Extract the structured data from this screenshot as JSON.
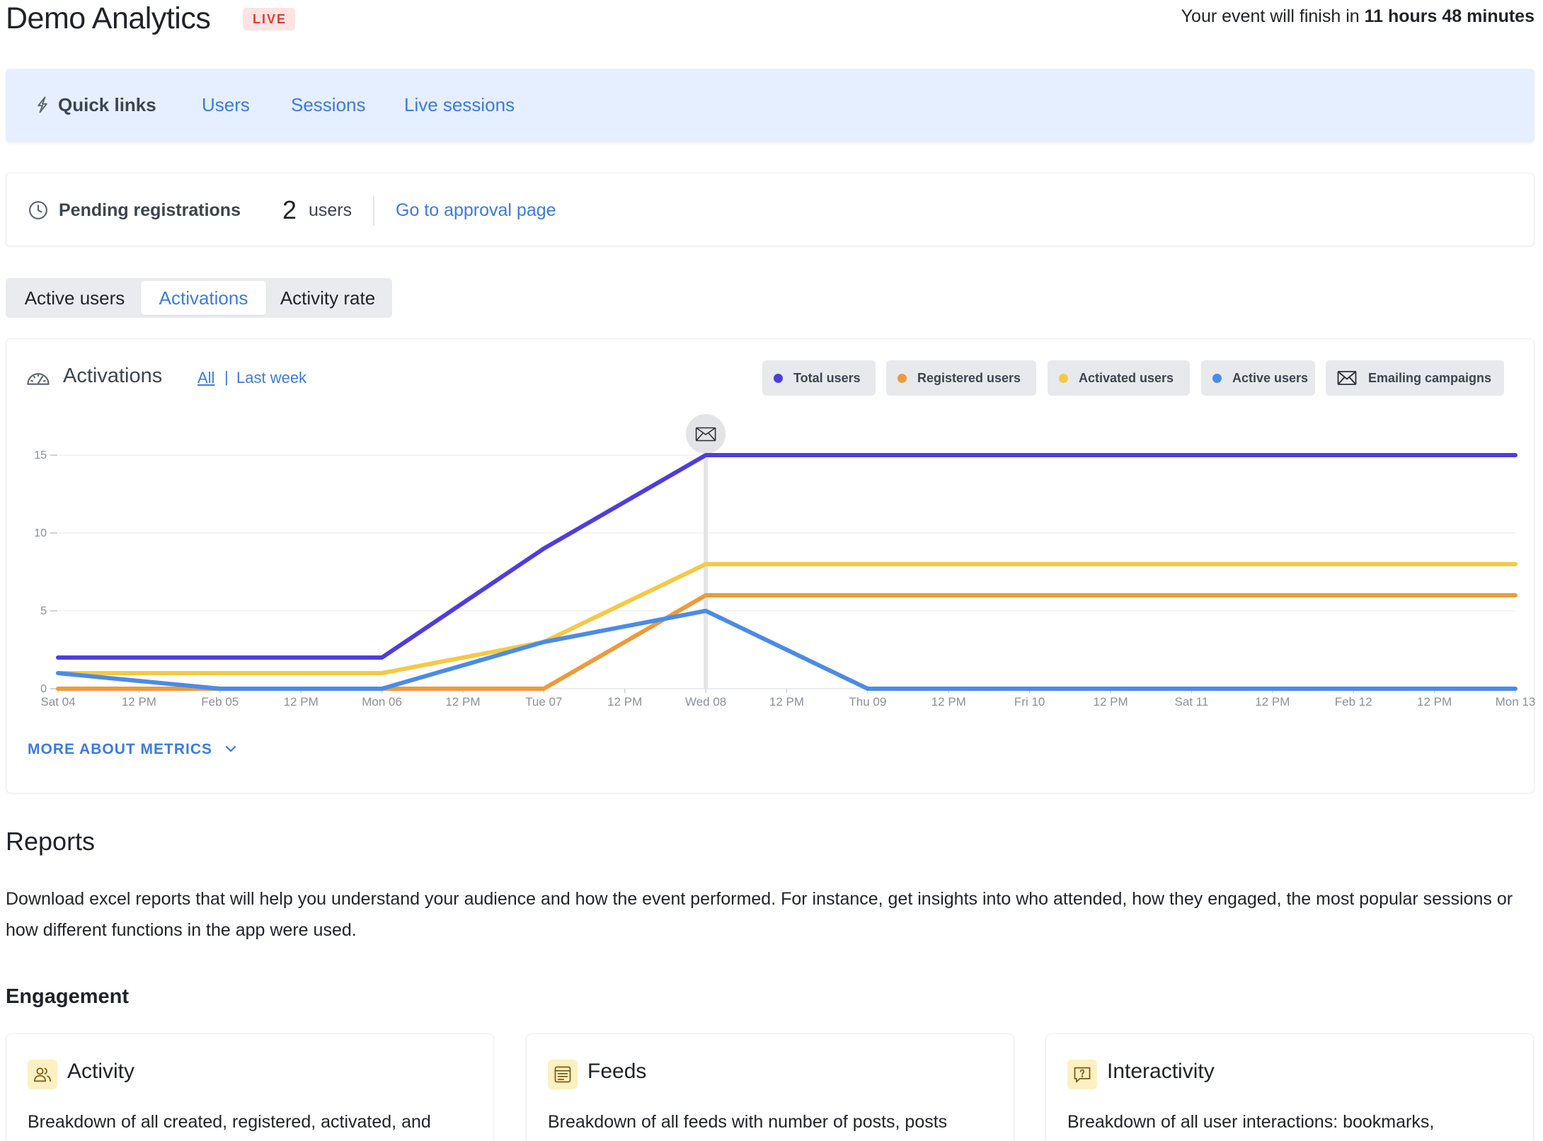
{
  "header": {
    "title": "Demo Analytics",
    "badge": "LIVE",
    "countdown_prefix": "Your event will finish in",
    "countdown_value": "11 hours 48 minutes"
  },
  "quick_links": {
    "title": "Quick links",
    "links": [
      "Users",
      "Sessions",
      "Live sessions"
    ]
  },
  "pending": {
    "label": "Pending registrations",
    "count": "2",
    "unit": "users",
    "link": "Go to approval page"
  },
  "tabs": [
    "Active users",
    "Activations",
    "Activity rate"
  ],
  "active_tab": "Activations",
  "chart_card": {
    "title": "Activations",
    "range_all": "All",
    "range_separator": "|",
    "range_last_week": "Last week",
    "more_metrics": "MORE ABOUT METRICS",
    "legend": [
      {
        "label": "Total users",
        "color": "#4e3ddf"
      },
      {
        "label": "Registered users",
        "color": "#ee9a3a"
      },
      {
        "label": "Activated users",
        "color": "#f5c945"
      },
      {
        "label": "Active users",
        "color": "#4b8be8"
      },
      {
        "label": "Emailing campaigns",
        "icon": "envelope-icon"
      }
    ]
  },
  "chart_data": {
    "type": "line",
    "x_ticks": [
      "Sat 04",
      "12 PM",
      "Feb 05",
      "12 PM",
      "Mon 06",
      "12 PM",
      "Tue 07",
      "12 PM",
      "Wed 08",
      "12 PM",
      "Thu 09",
      "12 PM",
      "Fri 10",
      "12 PM",
      "Sat 11",
      "12 PM",
      "Feb 12",
      "12 PM",
      "Mon 13"
    ],
    "x": [
      "Sat 04",
      "Feb 05",
      "Mon 06",
      "Tue 07",
      "Wed 08",
      "Thu 09",
      "Fri 10",
      "Sat 11",
      "Feb 12",
      "Mon 13"
    ],
    "y_ticks": [
      0,
      5,
      10,
      15
    ],
    "ylim": [
      0,
      15
    ],
    "grid": true,
    "campaign_marker_at": "Wed 08",
    "series": [
      {
        "name": "Total users",
        "color": "#4e3ddf",
        "values": [
          2,
          2,
          2,
          9,
          15,
          15,
          15,
          15,
          15,
          15
        ]
      },
      {
        "name": "Activated users",
        "color": "#f5c945",
        "values": [
          1,
          1,
          1,
          3,
          8,
          8,
          8,
          8,
          8,
          8
        ]
      },
      {
        "name": "Registered users",
        "color": "#ee9a3a",
        "values": [
          0,
          0,
          0,
          0,
          6,
          6,
          6,
          6,
          6,
          6
        ]
      },
      {
        "name": "Active users",
        "color": "#4b8be8",
        "values": [
          1,
          0,
          0,
          3,
          5,
          0,
          0,
          0,
          0,
          0
        ]
      }
    ]
  },
  "reports": {
    "title": "Reports",
    "description": "Download excel reports that will help you understand your audience and how the event performed. For instance, get insights into who attended, how they engaged, the most popular sessions or how different functions in the app were used.",
    "section": "Engagement",
    "cards": [
      {
        "title": "Activity",
        "icon": "users-icon",
        "desc": "Breakdown of all created, registered, activated, and"
      },
      {
        "title": "Feeds",
        "icon": "feed-icon",
        "desc": "Breakdown of all feeds with number of posts, posts"
      },
      {
        "title": "Interactivity",
        "icon": "question-bubble-icon",
        "desc": "Breakdown of all user interactions: bookmarks,"
      }
    ]
  }
}
